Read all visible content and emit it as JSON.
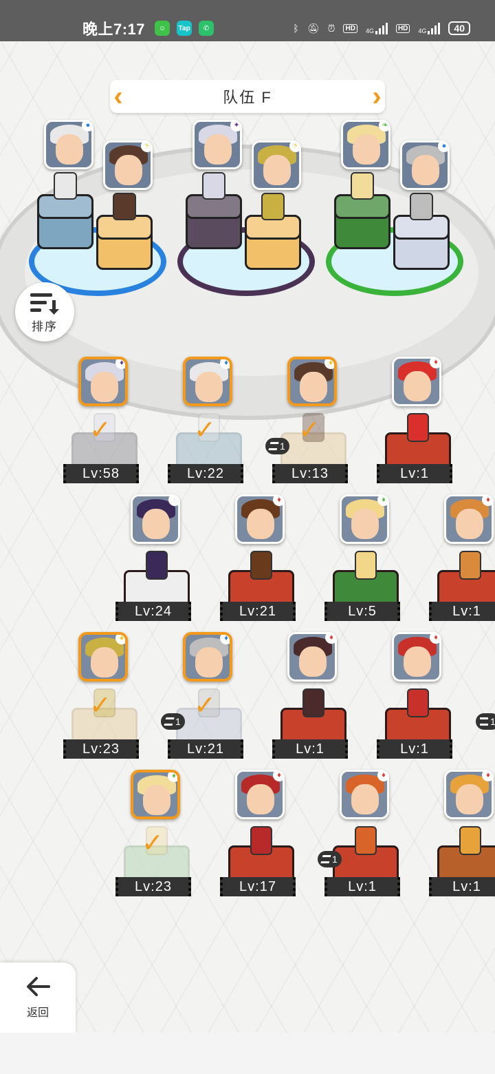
{
  "status_bar": {
    "time": "晚上7:17",
    "app_icons": [
      "chat-icon",
      "taptap-icon",
      "phone-icon"
    ],
    "tap_label": "Tap",
    "hd1": "HD",
    "net1": "4G",
    "hd2": "HD",
    "net2": "4G",
    "battery": "40"
  },
  "team": {
    "title": "队伍 F",
    "prev_icon": "chevron-left-icon",
    "next_icon": "chevron-right-icon"
  },
  "sort_button": {
    "label": "排序",
    "icon": "sort-icon"
  },
  "back_button": {
    "label": "返回",
    "icon": "arrow-left-icon"
  },
  "team_slots": [
    {
      "ring_color": "#2a82df",
      "members": [
        {
          "element": "water",
          "element_color": "#2a82df",
          "hair": "#e8e8e8",
          "plat": "#7fa6c0"
        },
        {
          "element": "lightning",
          "element_color": "#f2c51b",
          "hair": "#5a3a2a",
          "plat": "#f2c069"
        }
      ]
    },
    {
      "ring_color": "#4a3254",
      "members": [
        {
          "element": "dark",
          "element_color": "#6b3c8f",
          "hair": "#d8d8e6",
          "plat": "#5a4b5e"
        },
        {
          "element": "lightning",
          "element_color": "#f2c51b",
          "hair": "#c9b043",
          "plat": "#f2c069"
        }
      ]
    },
    {
      "ring_color": "#3ab33a",
      "members": [
        {
          "element": "earth",
          "element_color": "#5cc04a",
          "hair": "#f2dc9a",
          "plat": "#3f8a3a"
        },
        {
          "element": "water",
          "element_color": "#2a82df",
          "hair": "#bdbdbd",
          "plat": "#cfd6e6"
        }
      ]
    }
  ],
  "roster": [
    {
      "level": "Lv:58",
      "selected": true,
      "element_color": "#6b3c8f",
      "hair": "#d8d8e6",
      "ped": "#9a9aa0"
    },
    {
      "level": "Lv:22",
      "selected": true,
      "element_color": "#2a82df",
      "hair": "#e8e8e8",
      "ped": "#9fb8c8"
    },
    {
      "level": "Lv:13",
      "selected": true,
      "badge": "1",
      "element_color": "#f2c51b",
      "hair": "#5a3a2a",
      "ped": "#e8d2a8"
    },
    {
      "level": "Lv:1",
      "selected": false,
      "element_color": "#e03a3a",
      "hair": "#d9302c",
      "ped": "#c8412a"
    },
    {
      "level": "Lv:24",
      "selected": false,
      "element_color": "#f2f2f2",
      "hair": "#3a2a5a",
      "ped": "#eeeeee"
    },
    {
      "level": "Lv:21",
      "selected": false,
      "element_color": "#e03a3a",
      "hair": "#6a3a1c",
      "ped": "#c8412a"
    },
    {
      "level": "Lv:5",
      "selected": false,
      "element_color": "#5cc04a",
      "hair": "#f2d68a",
      "ped": "#3f8a3a"
    },
    {
      "level": "Lv:1",
      "selected": false,
      "element_color": "#e03a3a",
      "hair": "#d98a3a",
      "ped": "#c8412a"
    },
    {
      "level": "Lv:23",
      "selected": true,
      "element_color": "#f2c51b",
      "hair": "#c9b043",
      "ped": "#e8d2a8"
    },
    {
      "level": "Lv:21",
      "selected": true,
      "badge": "1",
      "element_color": "#2a82df",
      "hair": "#bdbdbd",
      "ped": "#c8d0dc"
    },
    {
      "level": "Lv:1",
      "selected": false,
      "element_color": "#e03a3a",
      "hair": "#4a2a2a",
      "ped": "#c8412a"
    },
    {
      "level": "Lv:1",
      "selected": false,
      "element_color": "#e03a3a",
      "hair": "#c8302a",
      "ped": "#c8412a"
    },
    {
      "level": "Lv:23",
      "selected": true,
      "element_color": "#5cc04a",
      "hair": "#f2dc9a",
      "ped": "#b8d8b8"
    },
    {
      "level": "Lv:17",
      "selected": false,
      "element_color": "#e03a3a",
      "hair": "#b82a2a",
      "ped": "#c8412a"
    },
    {
      "level": "Lv:1",
      "selected": false,
      "badge": "1",
      "element_color": "#e03a3a",
      "hair": "#d8642a",
      "ped": "#c8412a"
    },
    {
      "level": "Lv:1",
      "selected": false,
      "element_color": "#e03a3a",
      "hair": "#e8a23a",
      "ped": "#b8602a"
    }
  ],
  "edge_badge": "1"
}
